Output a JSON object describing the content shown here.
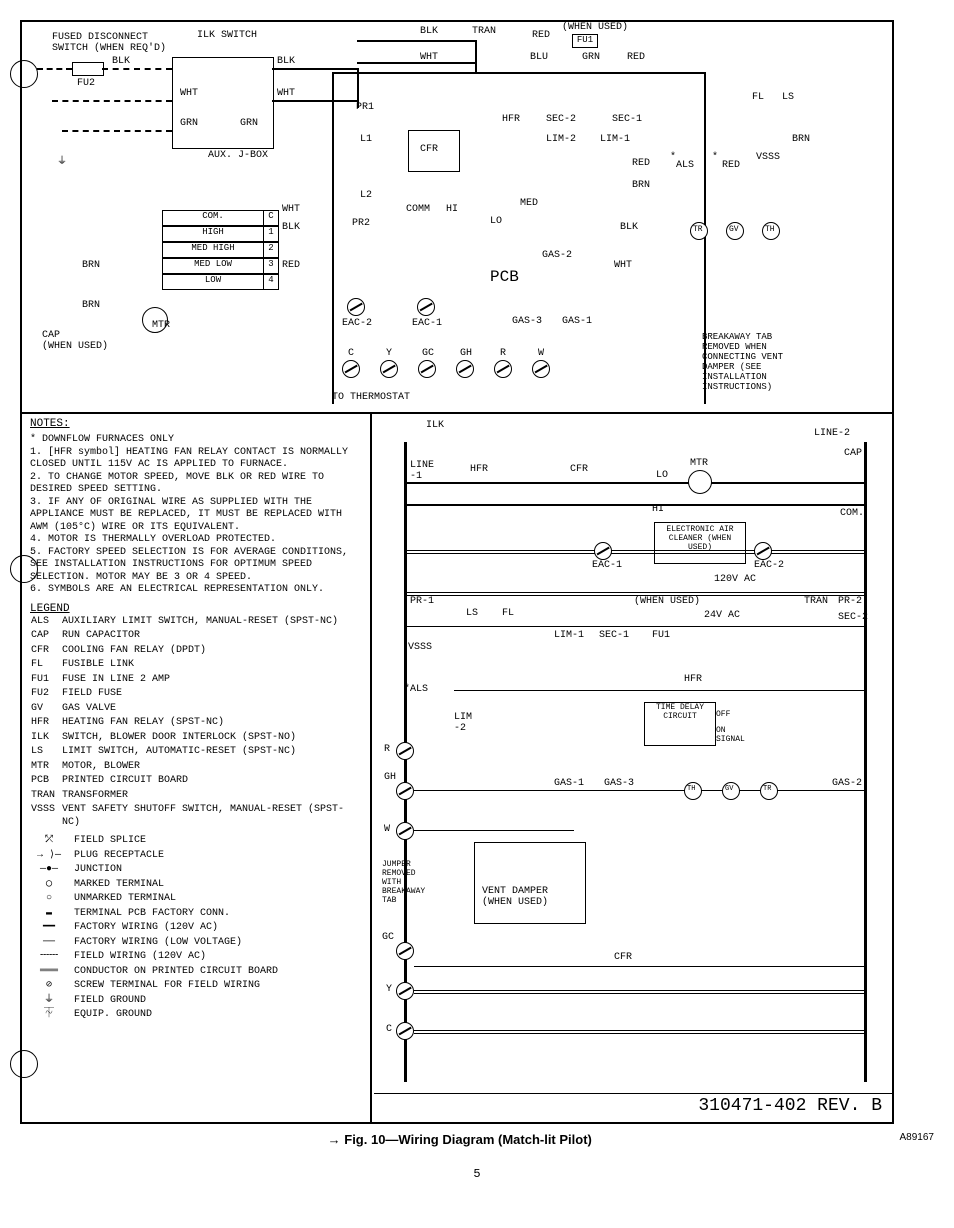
{
  "figure_caption": "→ Fig. 10—Wiring Diagram (Match-lit Pilot)",
  "figure_code": "A89167",
  "page_number": "5",
  "document_rev": "310471-402 REV. B",
  "upper_labels": {
    "fused_disconnect": "FUSED DISCONNECT\nSWITCH (WHEN REQ'D)",
    "ilk_switch": "ILK SWITCH",
    "fu2": "FU2",
    "blk1": "BLK",
    "blk2": "BLK",
    "wht1": "WHT",
    "wht2": "WHT",
    "grn1": "GRN",
    "grn2": "GRN",
    "aux_jbox": "AUX. J-BOX",
    "com": "COM.",
    "high": "HIGH",
    "med_high": "MED HIGH",
    "med_low": "MED LOW",
    "low": "LOW",
    "c": "C",
    "one": "1",
    "two": "2",
    "three": "3",
    "four": "4",
    "brn1": "BRN",
    "brn2": "BRN",
    "cap": "CAP\n(WHEN USED)",
    "mtr": "MTR",
    "blk3": "BLK",
    "wht3": "WHT",
    "red1": "RED",
    "pr1": "PR1",
    "l1": "L1",
    "l2": "L2",
    "pr2": "PR2",
    "eac2": "EAC-2",
    "eac1": "EAC-1",
    "c2": "C",
    "y": "Y",
    "gc": "GC",
    "gh": "GH",
    "r": "R",
    "w": "W",
    "to_thermostat": "TO THERMOSTAT",
    "comm": "COMM",
    "hi": "HI",
    "cfr": "CFR",
    "tran": "TRAN",
    "when_used": "(WHEN USED)",
    "fu1": "FU1",
    "red2": "RED",
    "blu": "BLU",
    "grn3": "GRN",
    "red3": "RED",
    "hfr": "HFR",
    "sec2": "SEC-2",
    "sec1": "SEC-1",
    "lim2": "LIM-2",
    "lim1": "LIM-1",
    "red4": "RED",
    "brn3": "BRN",
    "med": "MED",
    "lo": "LO",
    "blk4": "BLK",
    "gas2": "GAS-2",
    "wht4": "WHT",
    "pcb": "PCB",
    "gas3": "GAS-3",
    "gas1": "GAS-1",
    "fl": "FL",
    "ls": "LS",
    "als": "ALS",
    "star": "*",
    "red5": "RED",
    "vsss": "VSSS",
    "brn4": "BRN",
    "tr": "TR",
    "gv": "GV",
    "th": "TH",
    "breakaway": "BREAKAWAY TAB\nREMOVED WHEN\nCONNECTING VENT\nDAMPER (SEE\nINSTALLATION\nINSTRUCTIONS)"
  },
  "notes": {
    "title": "NOTES:",
    "star_note": "*  DOWNFLOW FURNACES ONLY",
    "items": [
      "1.  [HFR symbol]  HEATING FAN RELAY CONTACT IS NORMALLY CLOSED UNTIL 115V AC IS APPLIED TO FURNACE.",
      "2.  TO CHANGE MOTOR SPEED, MOVE BLK OR RED WIRE TO DESIRED SPEED SETTING.",
      "3.  IF ANY OF ORIGINAL WIRE AS SUPPLIED WITH THE APPLIANCE MUST BE REPLACED, IT MUST BE REPLACED WITH AWM (105°C) WIRE OR ITS EQUIVALENT.",
      "4.  MOTOR IS THERMALLY OVERLOAD PROTECTED.",
      "5.  FACTORY SPEED SELECTION IS FOR AVERAGE CONDITIONS, SEE INSTALLATION INSTRUCTIONS FOR OPTIMUM SPEED SELECTION.  MOTOR MAY BE 3 OR 4 SPEED.",
      "6.  SYMBOLS ARE AN ELECTRICAL REPRESENTATION ONLY."
    ]
  },
  "legend": {
    "title": "LEGEND",
    "entries": [
      [
        "ALS",
        "AUXILIARY LIMIT SWITCH, MANUAL-RESET (SPST-NC)"
      ],
      [
        "CAP",
        "RUN CAPACITOR"
      ],
      [
        "CFR",
        "COOLING FAN RELAY (DPDT)"
      ],
      [
        "FL",
        "FUSIBLE LINK"
      ],
      [
        "FU1",
        "FUSE IN LINE 2 AMP"
      ],
      [
        "FU2",
        "FIELD FUSE"
      ],
      [
        "GV",
        "GAS VALVE"
      ],
      [
        "HFR",
        "HEATING FAN RELAY (SPST-NC)"
      ],
      [
        "ILK",
        "SWITCH, BLOWER DOOR INTERLOCK (SPST-NO)"
      ],
      [
        "LS",
        "LIMIT SWITCH, AUTOMATIC-RESET (SPST-NC)"
      ],
      [
        "MTR",
        "MOTOR, BLOWER"
      ],
      [
        "PCB",
        "PRINTED CIRCUIT BOARD"
      ],
      [
        "TRAN",
        "TRANSFORMER"
      ],
      [
        "VSSS",
        "VENT SAFETY SHUTOFF SWITCH, MANUAL-RESET (SPST-NC)"
      ]
    ],
    "symbols": [
      [
        "⤱",
        "FIELD SPLICE"
      ],
      [
        "→ ⟩—",
        "PLUG RECEPTACLE"
      ],
      [
        "—●—",
        "JUNCTION"
      ],
      [
        "◯",
        "MARKED TERMINAL"
      ],
      [
        "○",
        "UNMARKED TERMINAL"
      ],
      [
        "▬",
        "TERMINAL PCB FACTORY CONN."
      ],
      [
        "━━",
        "FACTORY WIRING (120V AC)"
      ],
      [
        "──",
        "FACTORY WIRING (LOW VOLTAGE)"
      ],
      [
        "╌╌╌",
        "FIELD WIRING (120V AC)"
      ],
      [
        "═══",
        "CONDUCTOR ON PRINTED CIRCUIT BOARD"
      ],
      [
        "⊘",
        "SCREW TERMINAL FOR FIELD WIRING"
      ],
      [
        "⏚",
        "FIELD GROUND"
      ],
      [
        "⏇",
        "EQUIP. GROUND"
      ]
    ]
  },
  "ladder": {
    "ilk": "ILK",
    "line2": "LINE-2",
    "line1": "LINE\n-1",
    "hfr": "HFR",
    "cfr": "CFR",
    "mtr": "MTR",
    "cap": "CAP",
    "lo": "LO",
    "hi": "HI",
    "com2": "COM.",
    "eac1": "EAC-1",
    "eac2": "EAC-2",
    "electronic_ac": "ELECTRONIC\nAIR CLEANER\n(WHEN USED)",
    "pr1": "PR-1",
    "pr2": "PR-2",
    "v120": "120V AC",
    "tran": "TRAN",
    "when_used2": "(WHEN USED)",
    "v24": "24V AC",
    "sec1": "SEC-1",
    "sec2": "SEC-2",
    "fu1": "FU1",
    "ls": "LS",
    "fl": "FL",
    "lim1": "LIM-1",
    "vsss": "VSSS",
    "als": "*ALS",
    "lim2": "LIM\n-2",
    "time_delay": "TIME\nDELAY\nCIRCUIT",
    "off": "OFF",
    "on_signal": "ON\nSIGNAL",
    "hfr2": "HFR",
    "r": "R",
    "gh2": "GH",
    "gas1": "GAS-1",
    "gas3": "GAS-3",
    "gas2": "GAS-2",
    "th": "TH",
    "gv": "GV",
    "tr": "TR",
    "w": "W",
    "jumper_removed": "JUMPER\nREMOVED\nWITH\nBREAKAWAY\nTAB",
    "vent_damper": "VENT DAMPER\n(WHEN USED)",
    "cfr2": "CFR",
    "gc": "GC",
    "y2": "Y",
    "c3": "C"
  }
}
